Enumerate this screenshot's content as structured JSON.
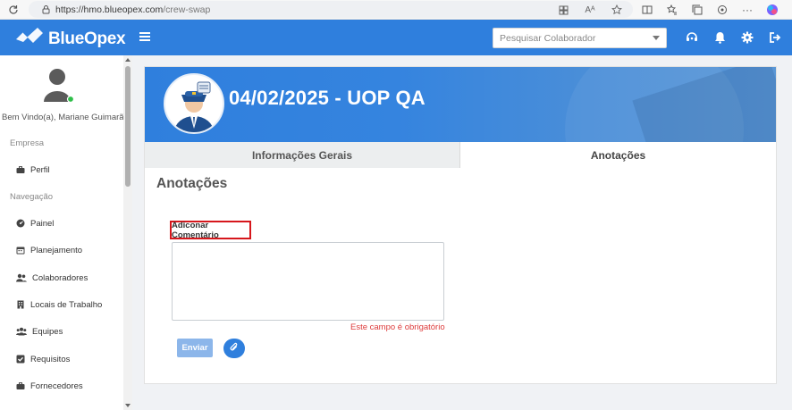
{
  "browser": {
    "url_host": "https://hmo.blueopex.com",
    "url_path": "/crew-swap"
  },
  "header": {
    "brand": "BlueOpex",
    "search_placeholder": "Pesquisar Colaborador",
    "icons": [
      "headset-icon",
      "bell-icon",
      "gear-icon",
      "logout-icon"
    ]
  },
  "sidebar": {
    "welcome": "Bem Vindo(a), Mariane Guimarães",
    "section_company": "Empresa",
    "section_nav": "Navegação",
    "items": [
      {
        "label": "Perfil",
        "icon": "briefcase-icon"
      },
      {
        "label": "Painel",
        "icon": "dashboard-icon"
      },
      {
        "label": "Planejamento",
        "icon": "calendar-icon"
      },
      {
        "label": "Colaboradores",
        "icon": "users-icon"
      },
      {
        "label": "Locais de Trabalho",
        "icon": "building-icon"
      },
      {
        "label": "Equipes",
        "icon": "team-icon"
      },
      {
        "label": "Requisitos",
        "icon": "checkbox-icon"
      },
      {
        "label": "Fornecedores",
        "icon": "briefcase-icon"
      }
    ]
  },
  "banner": {
    "title": "04/02/2025 - UOP QA"
  },
  "tabs": [
    {
      "label": "Informações Gerais",
      "active": false
    },
    {
      "label": "Anotações",
      "active": true
    }
  ],
  "notes": {
    "heading": "Anotações",
    "comment_label": "Adiconar Comentário",
    "comment_value": "",
    "required_message": "Este campo é obrigatório",
    "send_label": "Enviar"
  },
  "colors": {
    "brand_blue": "#2f7fdd",
    "error_red": "#dd3b3b",
    "highlight_red": "#d6171c"
  }
}
